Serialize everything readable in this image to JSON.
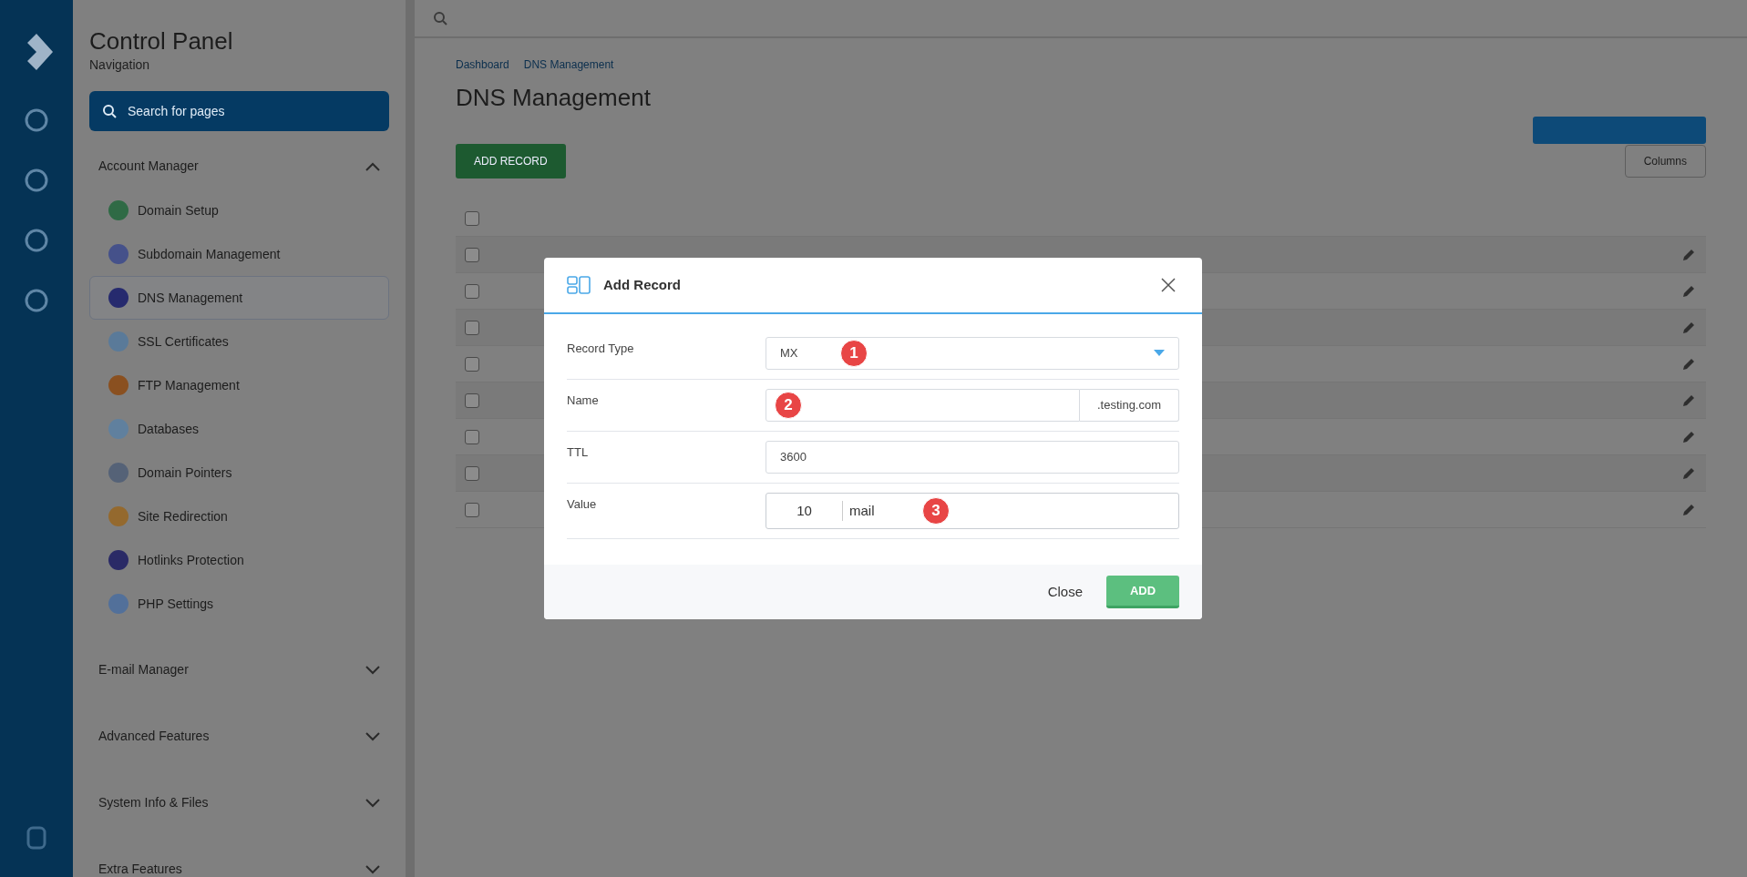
{
  "sidebar": {
    "title": "Control Panel",
    "subtitle": "Navigation",
    "search": {
      "placeholder": "Search for pages"
    },
    "sections": [
      {
        "label": "Account Manager",
        "expanded": true,
        "items": [
          {
            "label": "Domain Setup",
            "selected": false,
            "color": "#2f6a45"
          },
          {
            "label": "Subdomain Management",
            "selected": false,
            "color": "#45518a"
          },
          {
            "label": "DNS Management",
            "selected": true,
            "color": "#262a6e"
          },
          {
            "label": "SSL Certificates",
            "selected": false,
            "color": "#5a7a99"
          },
          {
            "label": "FTP Management",
            "selected": false,
            "color": "#8a5020"
          },
          {
            "label": "Databases",
            "selected": false,
            "color": "#60809e"
          },
          {
            "label": "Domain Pointers",
            "selected": false,
            "color": "#556277"
          },
          {
            "label": "Site Redirection",
            "selected": false,
            "color": "#94692e"
          },
          {
            "label": "Hotlinks Protection",
            "selected": false,
            "color": "#2a2a66"
          },
          {
            "label": "PHP Settings",
            "selected": false,
            "color": "#52709a"
          }
        ]
      },
      {
        "label": "E-mail Manager",
        "expanded": false
      },
      {
        "label": "Advanced Features",
        "expanded": false
      },
      {
        "label": "System Info & Files",
        "expanded": false
      },
      {
        "label": "Extra Features",
        "expanded": false
      }
    ]
  },
  "main": {
    "breadcrumb": [
      "Dashboard",
      "DNS Management"
    ],
    "title": "DNS Management",
    "add_button": "ADD RECORD",
    "columns_button": "Columns",
    "table": {
      "header_checked": false,
      "rows": [
        {
          "checked": false
        },
        {
          "checked": false
        },
        {
          "checked": false
        },
        {
          "checked": false
        },
        {
          "checked": false
        },
        {
          "checked": false
        },
        {
          "checked": false
        },
        {
          "checked": false
        }
      ]
    }
  },
  "modal": {
    "title": "Add Record",
    "fields": [
      {
        "kind": "select",
        "label": "Record Type",
        "value": "MX",
        "marker": "1"
      },
      {
        "kind": "suffix",
        "label": "Name",
        "suffix": ".testing.com",
        "marker": "2"
      },
      {
        "kind": "text",
        "label": "TTL",
        "value": "3600"
      },
      {
        "kind": "priority",
        "label": "Value",
        "priority": "10",
        "value": "mail",
        "marker": "3"
      }
    ],
    "close_button": "Close",
    "add_button": "ADD"
  }
}
